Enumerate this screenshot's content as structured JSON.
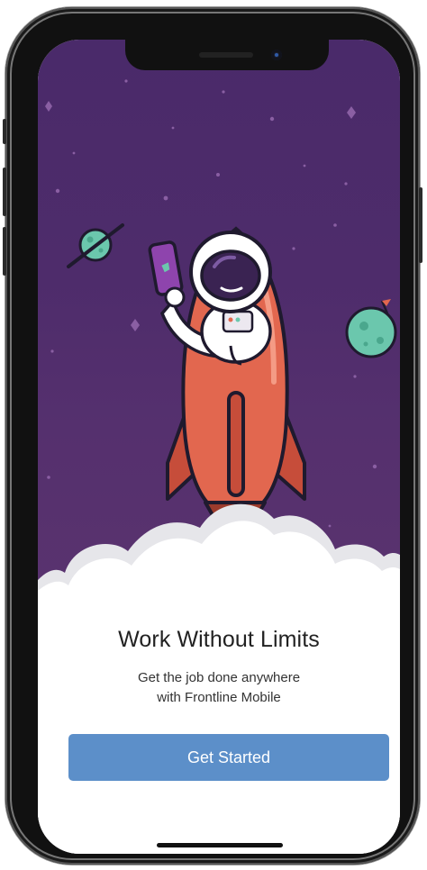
{
  "onboarding": {
    "title": "Work Without Limits",
    "subtitle_line1": "Get the job done anywhere",
    "subtitle_line2": "with Frontline Mobile",
    "cta_label": "Get Started"
  },
  "illustration": {
    "subject": "astronaut-riding-rocket",
    "elements": [
      "rocket",
      "astronaut",
      "phone",
      "ringed-planet",
      "moon-with-flag",
      "stars",
      "clouds"
    ]
  },
  "colors": {
    "sky": "#4e2c6b",
    "rocket": "#e2674f",
    "planet": "#6bc7ad",
    "button": "#5c8fc9",
    "text": "#222222"
  }
}
